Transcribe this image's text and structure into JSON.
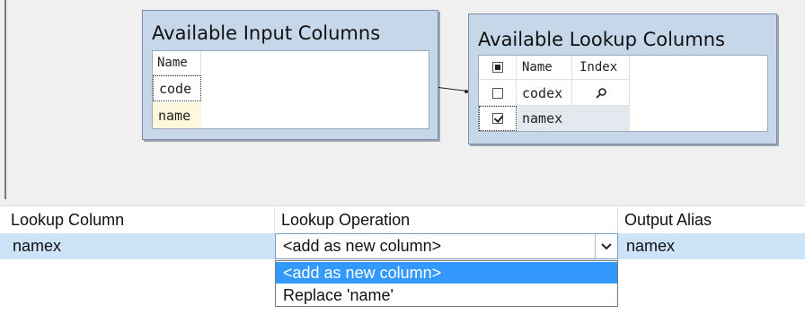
{
  "input_table": {
    "title": "Available Input Columns",
    "header": "Name",
    "columns": [
      "code",
      "name"
    ]
  },
  "lookup_table": {
    "title": "Available Lookup Columns",
    "headers": {
      "name": "Name",
      "index": "Index"
    },
    "columns": [
      {
        "name": "codex",
        "checked": false,
        "has_index": true
      },
      {
        "name": "namex",
        "checked": true,
        "has_index": false
      }
    ]
  },
  "grid": {
    "headers": [
      "Lookup Column",
      "Lookup Operation",
      "Output Alias"
    ],
    "rows": [
      {
        "lookup_column": "namex",
        "lookup_operation": "<add as new column>",
        "output_alias": "namex"
      }
    ]
  },
  "dropdown": {
    "options": [
      "<add as new column>",
      "Replace 'name'"
    ],
    "selected_index": 0
  },
  "colors": {
    "box_background": "#c7d7ea",
    "selected_row": "#cce3f8",
    "highlight": "#3399ff",
    "input_name_bg": "#fff8dc"
  }
}
